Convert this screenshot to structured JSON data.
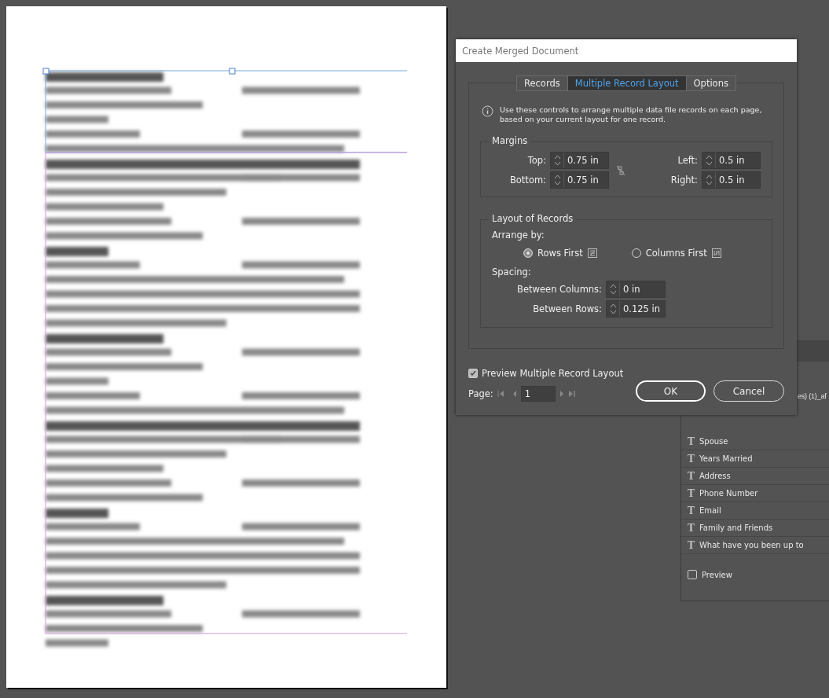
{
  "dialog": {
    "title": "Create Merged Document",
    "tabs": [
      {
        "label": "Records",
        "selected": false
      },
      {
        "label": "Multiple Record Layout",
        "selected": true
      },
      {
        "label": "Options",
        "selected": false
      }
    ],
    "info": "Use these controls to arrange multiple data file records on each page, based on your current layout for one record.",
    "margins": {
      "title": "Margins",
      "fields": [
        {
          "label": "Top:",
          "value": "0.75 in"
        },
        {
          "label": "Left:",
          "value": "0.5 in"
        },
        {
          "label": "Bottom:",
          "value": "0.75 in"
        },
        {
          "label": "Right:",
          "value": "0.5 in"
        }
      ]
    },
    "layout": {
      "title": "Layout of Records",
      "arrange_label": "Arrange by:",
      "options": [
        {
          "label": "Rows First",
          "selected": true
        },
        {
          "label": "Columns First",
          "selected": false
        }
      ],
      "spacing_label": "Spacing:",
      "spacing": [
        {
          "label": "Between Columns:",
          "value": "0 in"
        },
        {
          "label": "Between Rows:",
          "value": "0.125 in"
        }
      ]
    },
    "preview": {
      "label": "Preview Multiple Record Layout",
      "checked": true
    },
    "page": {
      "label": "Page:",
      "value": "1"
    },
    "buttons": [
      {
        "label": "OK",
        "default": true
      },
      {
        "label": "Cancel",
        "default": false
      }
    ]
  },
  "panel": {
    "source": "es) (1)_af",
    "fields": [
      {
        "icon": "T",
        "name": "Spouse"
      },
      {
        "icon": "T",
        "name": "Years Married"
      },
      {
        "icon": "T",
        "name": "Address"
      },
      {
        "icon": "T",
        "name": "Phone Number"
      },
      {
        "icon": "T",
        "name": "Email"
      },
      {
        "icon": "T",
        "name": "Family and Friends"
      },
      {
        "icon": "T",
        "name": "What have you been up to"
      }
    ],
    "preview": {
      "label": "Preview",
      "checked": false
    }
  }
}
